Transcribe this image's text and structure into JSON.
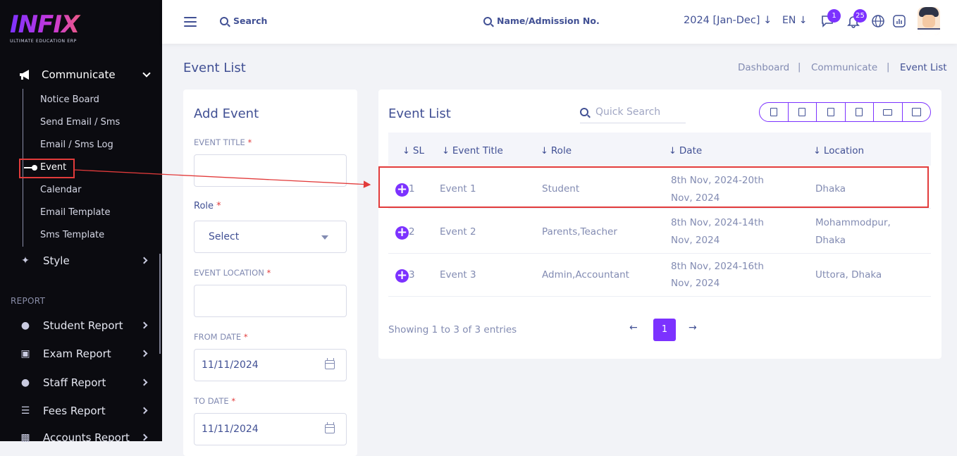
{
  "sidebar": {
    "logo_text": "INFIX",
    "logo_sub": "ULTIMATE EDUCATION ERP",
    "communicate_label": "Communicate",
    "sub_items": [
      "Notice Board",
      "Send Email / Sms",
      "Email / Sms Log",
      "Event",
      "Calendar",
      "Email Template",
      "Sms Template"
    ],
    "style_label": "Style",
    "report_heading": "REPORT",
    "reports": [
      "Student Report",
      "Exam Report",
      "Staff Report",
      "Fees Report",
      "Accounts Report"
    ]
  },
  "topbar": {
    "search_label": "Search",
    "name_search": "Name/Admission No.",
    "year": "2024 [Jan-Dec]",
    "lang": "EN",
    "chat_badge": "1",
    "notif_badge": "25"
  },
  "page": {
    "title": "Event List",
    "breadcrumbs": [
      "Dashboard",
      "Communicate",
      "Event List"
    ]
  },
  "form": {
    "title": "Add Event",
    "event_title_label": "EVENT TITLE",
    "role_label": "Role",
    "role_value": "Select",
    "location_label": "EVENT LOCATION",
    "from_label": "FROM DATE",
    "from_value": "11/11/2024",
    "to_label": "TO DATE",
    "to_value": "11/11/2024",
    "required_mark": "*"
  },
  "list": {
    "title": "Event List",
    "quick_search_placeholder": "Quick Search",
    "columns": [
      "SL",
      "Event Title",
      "Role",
      "Date",
      "Location"
    ],
    "rows": [
      {
        "sl": "1",
        "title": "Event 1",
        "role": "Student",
        "date1": "8th Nov, 2024-20th",
        "date2": "Nov, 2024",
        "loc1": "Dhaka",
        "loc2": ""
      },
      {
        "sl": "2",
        "title": "Event 2",
        "role": "Parents,Teacher",
        "date1": "8th Nov, 2024-14th",
        "date2": "Nov, 2024",
        "loc1": "Mohammodpur,",
        "loc2": "Dhaka"
      },
      {
        "sl": "3",
        "title": "Event 3",
        "role": "Admin,Accountant",
        "date1": "8th Nov, 2024-16th",
        "date2": "Nov, 2024",
        "loc1": "Uttora, Dhaka",
        "loc2": ""
      }
    ],
    "showing": "Showing 1 to 3 of 3 entries",
    "page_current": "1"
  },
  "colors": {
    "accent": "#7c32ff",
    "text": "#415094",
    "highlight": "#e23b3b"
  }
}
